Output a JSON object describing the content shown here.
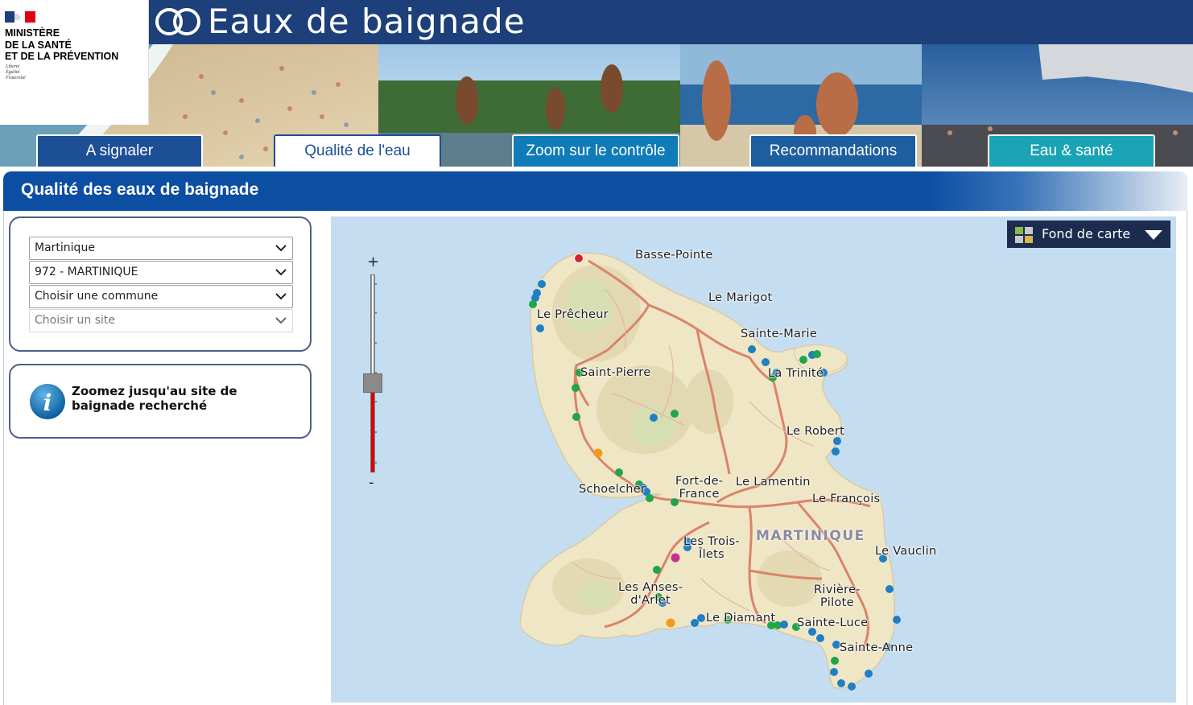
{
  "banner": {
    "site_title": "Eaux de baignade",
    "ministry_name": "MINISTÈRE\nDE LA SANTÉ\nET DE LA PRÉVENTION",
    "ministry_motto": "Liberté\nÉgalité\nFraternité",
    "title_color": "#1d3f7a"
  },
  "nav": {
    "tabs": [
      {
        "label": "A signaler",
        "active": false
      },
      {
        "label": "Qualité de l'eau",
        "active": true
      },
      {
        "label": "Zoom sur le contrôle",
        "active": false
      },
      {
        "label": "Recommandations",
        "active": false
      },
      {
        "label": "Eau & santé",
        "active": false
      }
    ]
  },
  "section": {
    "title": "Qualité des eaux de baignade"
  },
  "filters": {
    "region": "Martinique",
    "department": "972 - MARTINIQUE",
    "commune": "Choisir une commune",
    "site": "Choisir un site"
  },
  "info": {
    "icon": "info-icon",
    "message": "Zoomez jusqu'au site de baignade recherché"
  },
  "map": {
    "basemap_button_label": "Fond de carte",
    "zoom_in_label": "+",
    "zoom_out_label": "-",
    "zoom_level_fraction": 0.45,
    "island_label": "MARTINIQUE",
    "place_labels": [
      {
        "id": "basse-pointe",
        "text": "Basse-Pointe"
      },
      {
        "id": "le-marigot",
        "text": "Le Marigot"
      },
      {
        "id": "le-precheur",
        "text": "Le Prêcheur"
      },
      {
        "id": "sainte-marie",
        "text": "Sainte-Marie"
      },
      {
        "id": "saint-pierre",
        "text": "Saint-Pierre"
      },
      {
        "id": "la-trinite",
        "text": "La Trinité"
      },
      {
        "id": "le-robert",
        "text": "Le Robert"
      },
      {
        "id": "fort-de-france",
        "text": "Fort-de-\nFrance"
      },
      {
        "id": "le-lamentin",
        "text": "Le Lamentin"
      },
      {
        "id": "schoelcher",
        "text": "Schoelcher"
      },
      {
        "id": "le-francois",
        "text": "Le François"
      },
      {
        "id": "les-trois-ilets",
        "text": "Les Trois-\nÎlets"
      },
      {
        "id": "le-vauclin",
        "text": "Le Vauclin"
      },
      {
        "id": "les-anses-darlet",
        "text": "Les Anses-\nd'Arlet"
      },
      {
        "id": "riviere-pilote",
        "text": "Rivière-\nPilote"
      },
      {
        "id": "le-diamant",
        "text": "Le Diamant"
      },
      {
        "id": "sainte-luce",
        "text": "Sainte-Luce"
      },
      {
        "id": "sainte-anne",
        "text": "Sainte-Anne"
      }
    ],
    "marker_colors": {
      "blue": "#1f7fc4",
      "green": "#1fa64a",
      "red": "#d1262e",
      "orange": "#f39a1e",
      "magenta": "#c2318f"
    }
  },
  "colors": {
    "accent": "#0b4ea2",
    "panel_border": "#4e5e85",
    "sea": "#c5ddf0",
    "land": "#efe6c6"
  }
}
